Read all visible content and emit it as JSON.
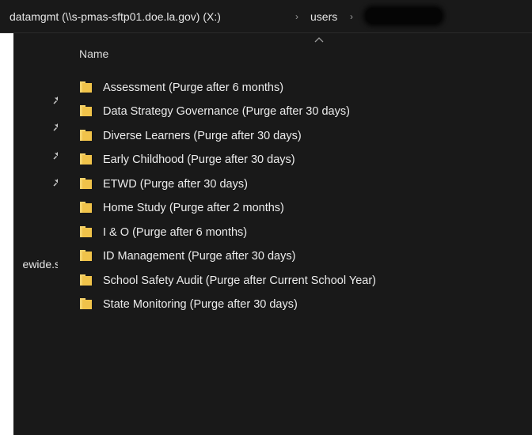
{
  "address_bar": {
    "drive_crumb": "datamgmt (\\\\s-pmas-sftp01.doe.la.gov) (X:)",
    "separator": "›",
    "users_crumb": "users"
  },
  "nav_pane": {
    "partial_item": "ewide.s",
    "pinned_count": 4
  },
  "file_list": {
    "column_header": "Name",
    "sort_indicator": "chevron-up-icon",
    "items": [
      {
        "label": "Assessment (Purge after 6 months)",
        "type": "folder"
      },
      {
        "label": "Data Strategy Governance (Purge after 30 days)",
        "type": "folder"
      },
      {
        "label": "Diverse Learners (Purge after 30 days)",
        "type": "folder"
      },
      {
        "label": "Early Childhood (Purge after 30 days)",
        "type": "folder"
      },
      {
        "label": "ETWD (Purge after 30 days)",
        "type": "folder"
      },
      {
        "label": "Home Study (Purge after 2 months)",
        "type": "folder"
      },
      {
        "label": "I & O (Purge after 6 months)",
        "type": "folder"
      },
      {
        "label": "ID Management (Purge after 30 days)",
        "type": "folder"
      },
      {
        "label": "School Safety Audit (Purge after Current School Year)",
        "type": "folder"
      },
      {
        "label": "State Monitoring (Purge after 30 days)",
        "type": "folder"
      }
    ]
  },
  "colors": {
    "background": "#191919",
    "folder": "#f0c34a",
    "text": "#ececec"
  }
}
